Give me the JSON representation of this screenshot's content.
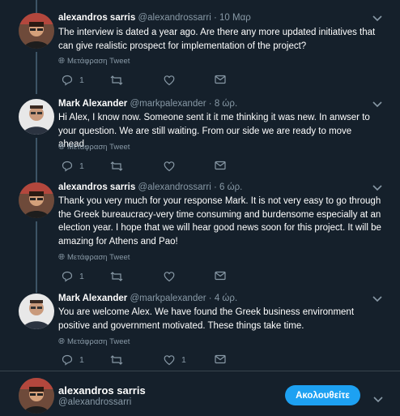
{
  "tweets": [
    {
      "name": "alexandros sarris",
      "handle": "@alexandrossarri",
      "dot": "·",
      "time": "10 Μαρ",
      "text": "The interview is dated a year ago. Are there any more updated initiatives that can give realistic prospect for implementation of the project?",
      "translate": "Μετάφραση Tweet",
      "reply_count": "1",
      "retweet_count": "",
      "like_count": ""
    },
    {
      "name": "Mark Alexander",
      "handle": "@markpalexander",
      "dot": "·",
      "time": "8 ώρ.",
      "text": "Hi Alex, I know now. Someone sent it it me thinking it was new. In anwser to your question. We are still waiting. From our side we are ready to move ahead.",
      "translate": "Μετάφραση Tweet",
      "reply_count": "1",
      "retweet_count": "",
      "like_count": ""
    },
    {
      "name": "alexandros sarris",
      "handle": "@alexandrossarri",
      "dot": "·",
      "time": "6 ώρ.",
      "text": "Thank you very much for your response Mark. It is not very easy to go through the Greek bureaucracy-very time consuming and burdensome especially at an election year. I hope that we will hear good news soon for this project. It will be amazing for Athens and Pao!",
      "translate": "Μετάφραση Tweet",
      "reply_count": "1",
      "retweet_count": "",
      "like_count": ""
    },
    {
      "name": "Mark Alexander",
      "handle": "@markpalexander",
      "dot": "·",
      "time": "4 ώρ.",
      "text": "You are welcome Alex. We have found the Greek business environment positive and government motivated. These things take time.",
      "translate": "Μετάφραση Tweet",
      "reply_count": "1",
      "retweet_count": "",
      "like_count": "1"
    }
  ],
  "profile": {
    "name": "alexandros sarris",
    "handle": "@alexandrossarri",
    "follow_label": "Ακολουθείτε"
  },
  "colors": {
    "background": "#15202b",
    "accent": "#1da1f2",
    "muted": "#8899a6",
    "separator": "#38444d"
  },
  "icons": [
    "reply-icon",
    "retweet-icon",
    "like-icon",
    "message-icon",
    "chevron-down-icon",
    "globe-icon"
  ]
}
